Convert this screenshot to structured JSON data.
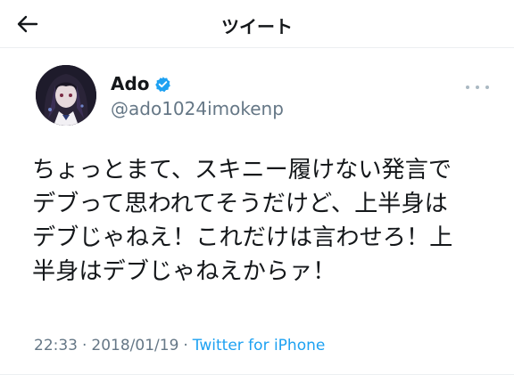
{
  "header": {
    "title": "ツイート",
    "back_icon": "arrow-left-icon"
  },
  "user": {
    "name": "Ado",
    "handle": "@ado1024imokenp",
    "verified_icon": "verified-badge-icon",
    "verified_color": "#1da1f2"
  },
  "tweet": {
    "text": "ちょっとまて、スキニー履けない発言で\nデブって思われてそうだけど、上半身は\nデブじゃねえ！これだけは言わせろ！上\n半身はデブじゃねえからァ！",
    "time": "22:33",
    "separator": "·",
    "date": "2018/01/19",
    "source": "Twitter for iPhone"
  },
  "colors": {
    "accent": "#1da1f2",
    "text": "#14171a",
    "muted": "#657786"
  }
}
